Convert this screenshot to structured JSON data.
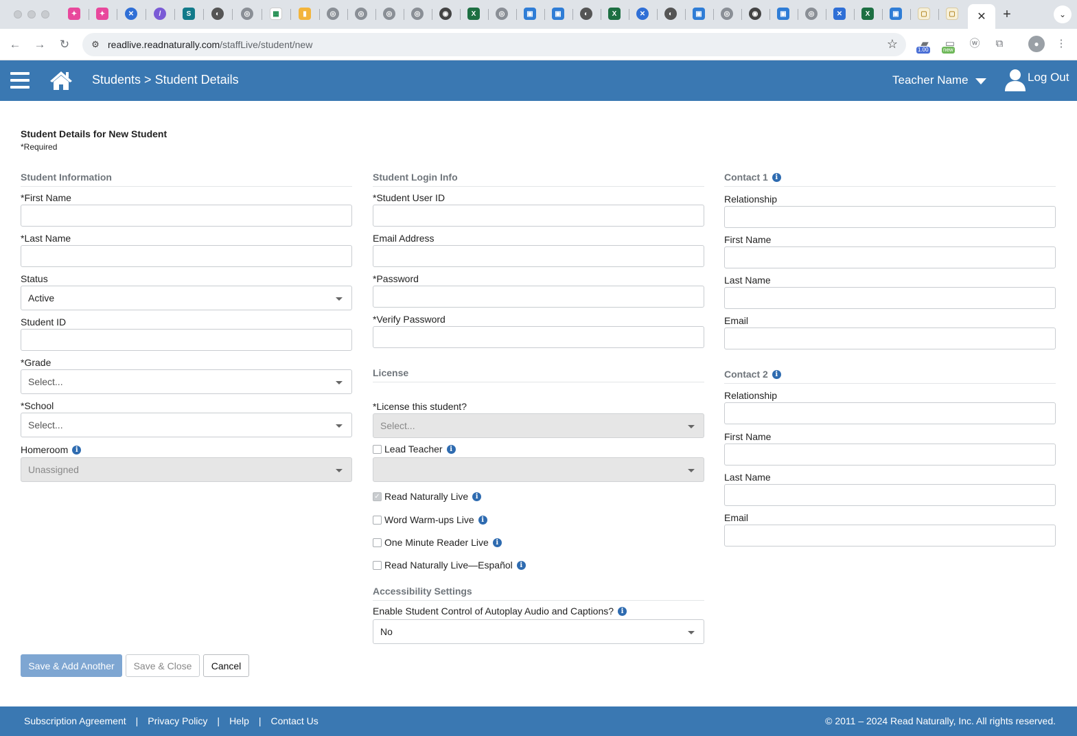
{
  "browser": {
    "url_host": "readlive.readnaturally.com",
    "url_path": "/staffLive/student/new",
    "tab_close": "✕",
    "new_tab": "+",
    "tab_menu": "⌄",
    "ext_badge_1": "1.00",
    "ext_badge_2": "new"
  },
  "header": {
    "breadcrumb": "Students > Student Details",
    "teacher_name": "Teacher Name",
    "logout_label": "Log Out"
  },
  "page": {
    "title": "Student Details for New Student",
    "required_note": "*Required"
  },
  "student_information": {
    "title": "Student Information",
    "first_name_label": "*First Name",
    "last_name_label": "*Last Name",
    "status_label": "Status",
    "status_value": "Active",
    "student_id_label": "Student ID",
    "grade_label": "*Grade",
    "grade_value": "Select...",
    "school_label": "*School",
    "school_value": "Select...",
    "homeroom_label": "Homeroom",
    "homeroom_value": "Unassigned"
  },
  "student_login": {
    "title": "Student Login Info",
    "user_id_label": "*Student User ID",
    "email_label": "Email Address",
    "password_label": "*Password",
    "verify_password_label": "*Verify Password"
  },
  "license": {
    "title": "License",
    "license_label": "*License this student?",
    "license_value": "Select...",
    "lead_teacher_label": "Lead Teacher",
    "lead_teacher_value": "",
    "products": [
      {
        "label": "Read Naturally Live",
        "checked": true
      },
      {
        "label": "Word Warm-ups Live",
        "checked": false
      },
      {
        "label": "One Minute Reader Live",
        "checked": false
      },
      {
        "label": "Read Naturally Live—Español",
        "checked": false
      }
    ]
  },
  "accessibility": {
    "title": "Accessibility Settings",
    "autoplay_label": "Enable Student Control of Autoplay Audio and Captions?",
    "autoplay_value": "No"
  },
  "contact1": {
    "title": "Contact 1",
    "relationship_label": "Relationship",
    "first_name_label": "First Name",
    "last_name_label": "Last Name",
    "email_label": "Email"
  },
  "contact2": {
    "title": "Contact 2",
    "relationship_label": "Relationship",
    "first_name_label": "First Name",
    "last_name_label": "Last Name",
    "email_label": "Email"
  },
  "buttons": {
    "save_add": "Save & Add Another",
    "save_close": "Save & Close",
    "cancel": "Cancel"
  },
  "footer": {
    "links": [
      "Subscription Agreement",
      "Privacy Policy",
      "Help",
      "Contact Us"
    ],
    "separator": "|",
    "copyright": "© 2011 – 2024 Read Naturally, Inc. All rights reserved."
  },
  "colors": {
    "brand_blue": "#3a78b2",
    "primary_button": "#7ea6d2",
    "info_icon": "#2e6bb0"
  }
}
